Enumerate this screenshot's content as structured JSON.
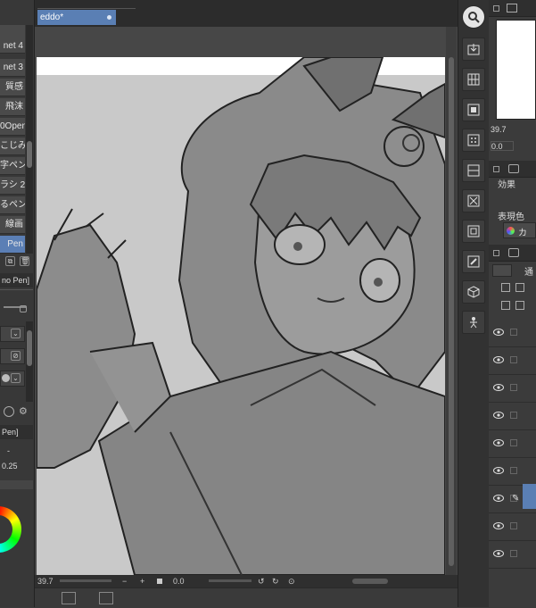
{
  "brush_list": {
    "items": [
      {
        "label": "net 4",
        "selected": false
      },
      {
        "label": "",
        "selected": true
      },
      {
        "label": "net 3",
        "selected": false
      },
      {
        "label": "質感",
        "selected": false
      },
      {
        "label": "飛沫",
        "selected": false
      },
      {
        "label": "0Open",
        "selected": false
      },
      {
        "label": "こじみ",
        "selected": false
      },
      {
        "label": "字ペン",
        "selected": false
      },
      {
        "label": "ラシ 2",
        "selected": false
      },
      {
        "label": "るペン",
        "selected": false
      },
      {
        "label": "線画",
        "selected": false
      },
      {
        "label": "Pen",
        "selected": true
      }
    ]
  },
  "tool_property": {
    "tab_label": "no Pen]",
    "sub_tab_label": "Pen]",
    "value_a": "-",
    "value_b": "0.25"
  },
  "document": {
    "tab_title": "eddo*"
  },
  "status_bar": {
    "zoom": "39.7",
    "angle": "0.0"
  },
  "navigator": {
    "zoom": "39.7",
    "angle": "0.0"
  },
  "layer_property": {
    "effect_label": "効果",
    "display_color_label": "表現色",
    "color_value": "カ"
  },
  "layers": {
    "blend_mode": "通",
    "rows": [
      {
        "visible": true
      },
      {
        "visible": true
      },
      {
        "visible": true
      },
      {
        "visible": true
      },
      {
        "visible": true
      },
      {
        "visible": true
      },
      {
        "visible": true
      },
      {
        "visible": true
      },
      {
        "visible": true
      }
    ]
  },
  "colors": {
    "accent": "#5a7fb4",
    "panel": "#3b3b3b",
    "canvas_bg": "#474747"
  }
}
